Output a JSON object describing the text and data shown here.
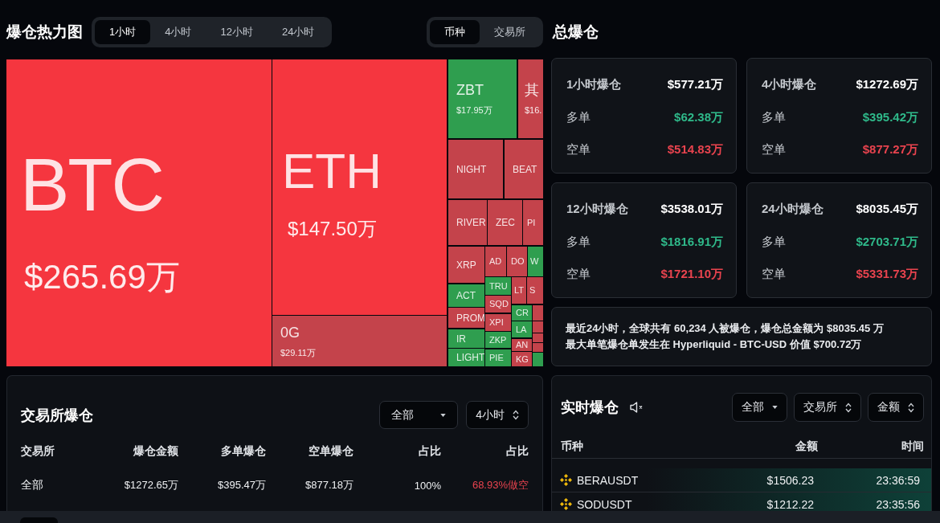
{
  "header": {
    "title": "爆仓热力图",
    "range_tabs": [
      {
        "label": "1小时",
        "selected": true
      },
      {
        "label": "4小时",
        "selected": false
      },
      {
        "label": "12小时",
        "selected": false
      },
      {
        "label": "24小时",
        "selected": false
      }
    ],
    "view_tabs": [
      {
        "label": "币种",
        "selected": true
      },
      {
        "label": "交易所",
        "selected": false
      }
    ]
  },
  "heatmap": {
    "tiles": [
      {
        "symbol": "BTC",
        "value": "$265.69万",
        "color": "#f5363f"
      },
      {
        "symbol": "ETH",
        "value": "$147.50万",
        "color": "#f5363f"
      },
      {
        "symbol": "0G",
        "value": "$29.11万",
        "color": "#c4434b"
      },
      {
        "symbol": "ZBT",
        "value": "$17.95万",
        "color": "#2f9e4f"
      },
      {
        "symbol": "其",
        "value": "$16.",
        "color": "#c4434b"
      },
      {
        "symbol": "NIGHT",
        "color": "#c4434b"
      },
      {
        "symbol": "BEAT",
        "color": "#c4434b"
      },
      {
        "symbol": "RIVER",
        "color": "#c4434b"
      },
      {
        "symbol": "ZEC",
        "color": "#c4434b"
      },
      {
        "symbol": "PI",
        "color": "#c4434b"
      },
      {
        "symbol": "XRP",
        "color": "#c4434b"
      },
      {
        "symbol": "AD",
        "color": "#c4434b"
      },
      {
        "symbol": "DO",
        "color": "#c4434b"
      },
      {
        "symbol": "W",
        "color": "#2f9e4f"
      },
      {
        "symbol": "ACT",
        "color": "#2f9e4f"
      },
      {
        "symbol": "PROM",
        "color": "#c4434b"
      },
      {
        "symbol": "IR",
        "color": "#2f9e4f"
      },
      {
        "symbol": "LIGHT",
        "color": "#2f9e4f"
      },
      {
        "symbol": "TRU",
        "color": "#2f9e4f"
      },
      {
        "symbol": "SQD",
        "color": "#c4434b"
      },
      {
        "symbol": "XPI",
        "color": "#c4434b"
      },
      {
        "symbol": "ZKP",
        "color": "#2f9e4f"
      },
      {
        "symbol": "PIE",
        "color": "#2f9e4f"
      },
      {
        "symbol": "LT",
        "color": "#c4434b"
      },
      {
        "symbol": "S",
        "color": "#c4434b"
      },
      {
        "symbol": "CR",
        "color": "#2f9e4f"
      },
      {
        "symbol": "LA",
        "color": "#2f9e4f"
      },
      {
        "symbol": "AN",
        "color": "#c4434b"
      },
      {
        "symbol": "KG",
        "color": "#c4434b"
      },
      {
        "color": "#c4434b"
      },
      {
        "color": "#c4434b"
      },
      {
        "color": "#c4434b"
      },
      {
        "color": "#c4434b"
      },
      {
        "color": "#2f9e4f"
      }
    ]
  },
  "totals": {
    "title": "总爆仓",
    "cards": [
      {
        "title": "1小时爆仓",
        "total": "$577.21万",
        "rows": [
          {
            "label": "多单",
            "value": "$62.38万",
            "kind": "long"
          },
          {
            "label": "空单",
            "value": "$514.83万",
            "kind": "short"
          }
        ]
      },
      {
        "title": "4小时爆仓",
        "total": "$1272.69万",
        "rows": [
          {
            "label": "多单",
            "value": "$395.42万",
            "kind": "long"
          },
          {
            "label": "空单",
            "value": "$877.27万",
            "kind": "short"
          }
        ]
      },
      {
        "title": "12小时爆仓",
        "total": "$3538.01万",
        "rows": [
          {
            "label": "多单",
            "value": "$1816.91万",
            "kind": "long"
          },
          {
            "label": "空单",
            "value": "$1721.10万",
            "kind": "short"
          }
        ]
      },
      {
        "title": "24小时爆仓",
        "total": "$8035.45万",
        "rows": [
          {
            "label": "多单",
            "value": "$2703.71万",
            "kind": "long"
          },
          {
            "label": "空单",
            "value": "$5331.73万",
            "kind": "short"
          }
        ]
      }
    ],
    "summary": [
      "最近24小时，全球共有 60,234 人被爆仓，爆仓总金额为 $8035.45 万",
      "最大单笔爆仓单发生在 Hyperliquid - BTC-USD 价值 $700.72万"
    ]
  },
  "exchange_panel": {
    "title": "交易所爆仓",
    "filters": [
      {
        "label": "全部",
        "kind": "dropdown"
      },
      {
        "label": "4小时",
        "kind": "sort"
      }
    ],
    "columns": [
      "交易所",
      "爆仓金额",
      "多单爆仓",
      "空单爆仓",
      "占比",
      "占比"
    ],
    "rows": [
      {
        "exchange": "全部",
        "total": "$1272.65万",
        "long": "$395.47万",
        "short": "$877.18万",
        "share": "100%",
        "ratio": {
          "text": "68.93%做空",
          "color": "#e8434e"
        }
      }
    ]
  },
  "live_panel": {
    "title": "实时爆仓",
    "muted": true,
    "filters": [
      {
        "label": "全部",
        "kind": "dropdown"
      },
      {
        "label": "交易所",
        "kind": "sort"
      },
      {
        "label": "金额",
        "kind": "sort"
      }
    ],
    "columns": [
      "币种",
      "金额",
      "时间"
    ],
    "rows": [
      {
        "symbol": "BERAUSDT",
        "amount": "$1506.23",
        "time": "23:36:59",
        "highlighted": true
      },
      {
        "symbol": "SODUSDT",
        "amount": "$1212.22",
        "time": "23:35:56",
        "highlighted": true
      }
    ]
  }
}
